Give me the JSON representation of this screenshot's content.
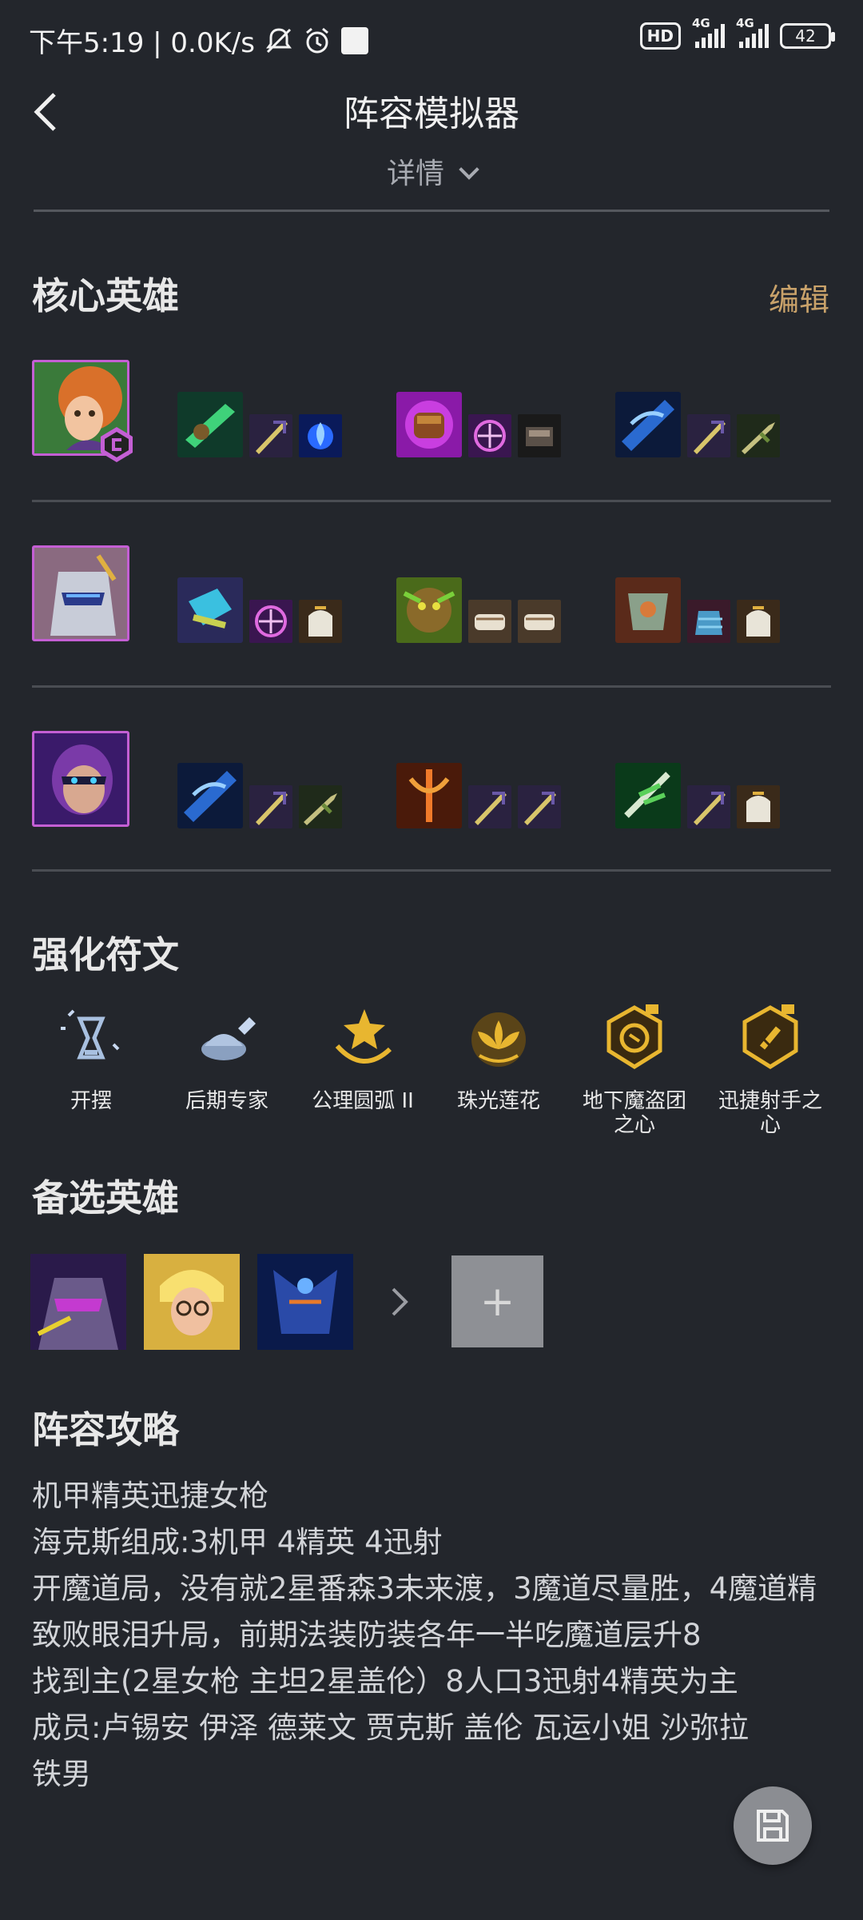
{
  "status_bar": {
    "time_speed": "下午5:19 | 0.0K/s",
    "hd": "HD",
    "net1": "4G",
    "net2": "4G",
    "battery": "42"
  },
  "header": {
    "title": "阵容模拟器",
    "details_label": "详情"
  },
  "core_heroes": {
    "title": "核心英雄",
    "edit_label": "编辑",
    "heroes": [
      {
        "name": "hero-1"
      },
      {
        "name": "hero-2"
      },
      {
        "name": "hero-3"
      }
    ]
  },
  "augments": {
    "title": "强化符文",
    "items": [
      {
        "label": "开摆"
      },
      {
        "label": "后期专家"
      },
      {
        "label": "公理圆弧 II"
      },
      {
        "label": "珠光莲花"
      },
      {
        "label": "地下魔盗团\n之心"
      },
      {
        "label": "迅捷射手之\n心"
      }
    ]
  },
  "alternates": {
    "title": "备选英雄",
    "add_label": "+"
  },
  "guide": {
    "title": "阵容攻略",
    "lines": [
      "机甲精英迅捷女枪",
      "海克斯组成:3机甲 4精英 4迅射",
      "开魔道局，没有就2星番森3未来渡，3魔道尽量胜，4魔道精致败眼泪升局，前期法装防装各年一半吃魔道层升8",
      "找到主(2星女枪 主坦2星盖伦）8人口3迅射4精英为主",
      "成员:卢锡安 伊泽 德莱文 贾克斯 盖伦 瓦运小姐 沙弥拉",
      "铁男"
    ]
  },
  "colors": {
    "background": "#23262c",
    "accent_edit": "#c9a26a",
    "portrait_border": "#c45fd4",
    "augment_gold": "#e8b630"
  }
}
